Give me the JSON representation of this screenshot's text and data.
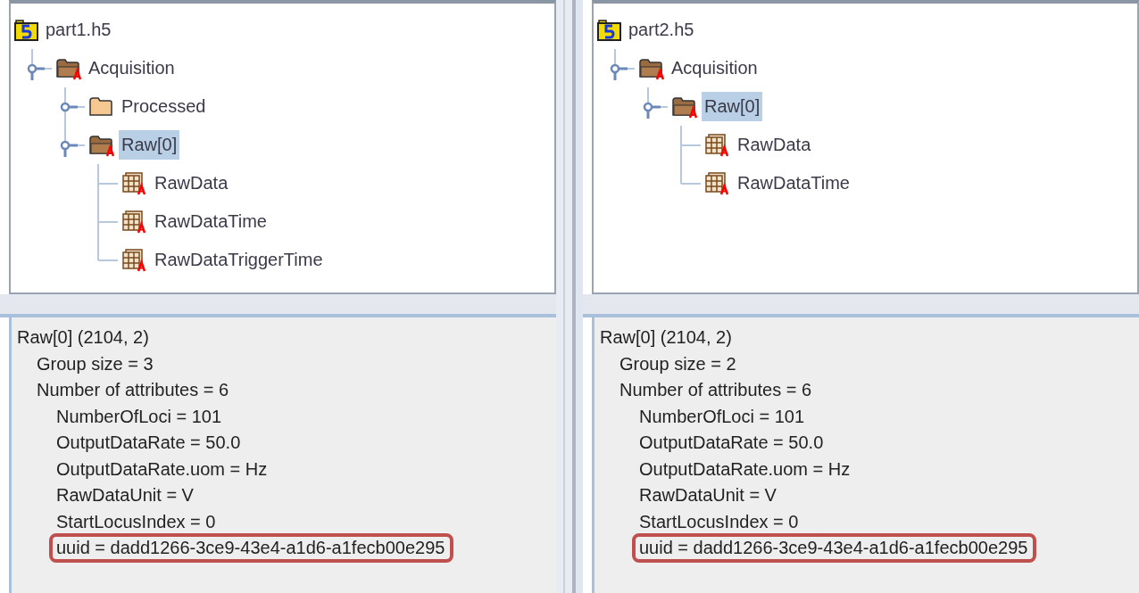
{
  "panels": [
    {
      "tree": {
        "label": "part1.h5",
        "kind": "file",
        "selected": false,
        "children": [
          {
            "label": "Acquisition",
            "kind": "group",
            "selected": false,
            "expanded": true,
            "children": [
              {
                "label": "Processed",
                "kind": "group",
                "selected": false,
                "expanded": false
              },
              {
                "label": "Raw[0]",
                "kind": "group",
                "selected": true,
                "expanded": true,
                "children": [
                  {
                    "label": "RawData",
                    "kind": "dataset",
                    "selected": false
                  },
                  {
                    "label": "RawDataTime",
                    "kind": "dataset",
                    "selected": false
                  },
                  {
                    "label": "RawDataTriggerTime",
                    "kind": "dataset",
                    "selected": false
                  }
                ]
              }
            ]
          }
        ]
      },
      "info": {
        "text": "Raw[0] (2104, 2)",
        "children": [
          {
            "text": "Group size = 3"
          },
          {
            "text": "Number of attributes = 6",
            "children": [
              {
                "text": "NumberOfLoci = 101",
                "highlighted": false
              },
              {
                "text": "OutputDataRate = 50.0",
                "highlighted": false
              },
              {
                "text": "OutputDataRate.uom = Hz",
                "highlighted": false
              },
              {
                "text": "RawDataUnit = V",
                "highlighted": false
              },
              {
                "text": "StartLocusIndex = 0",
                "highlighted": false
              },
              {
                "text": "uuid = dadd1266-3ce9-43e4-a1d6-a1fecb00e295",
                "highlighted": true
              }
            ]
          }
        ]
      }
    },
    {
      "tree": {
        "label": "part2.h5",
        "kind": "file",
        "selected": false,
        "children": [
          {
            "label": "Acquisition",
            "kind": "group",
            "selected": false,
            "expanded": true,
            "children": [
              {
                "label": "Raw[0]",
                "kind": "group",
                "selected": true,
                "expanded": true,
                "children": [
                  {
                    "label": "RawData",
                    "kind": "dataset",
                    "selected": false
                  },
                  {
                    "label": "RawDataTime",
                    "kind": "dataset",
                    "selected": false
                  }
                ]
              }
            ]
          }
        ]
      },
      "info": {
        "text": "Raw[0] (2104, 2)",
        "children": [
          {
            "text": "Group size = 2"
          },
          {
            "text": "Number of attributes = 6",
            "children": [
              {
                "text": "NumberOfLoci = 101",
                "highlighted": false
              },
              {
                "text": "OutputDataRate = 50.0",
                "highlighted": false
              },
              {
                "text": "OutputDataRate.uom = Hz",
                "highlighted": false
              },
              {
                "text": "RawDataUnit = V",
                "highlighted": false
              },
              {
                "text": "StartLocusIndex = 0",
                "highlighted": false
              },
              {
                "text": "uuid = dadd1266-3ce9-43e4-a1d6-a1fecb00e295",
                "highlighted": true
              }
            ]
          }
        ]
      }
    }
  ]
}
